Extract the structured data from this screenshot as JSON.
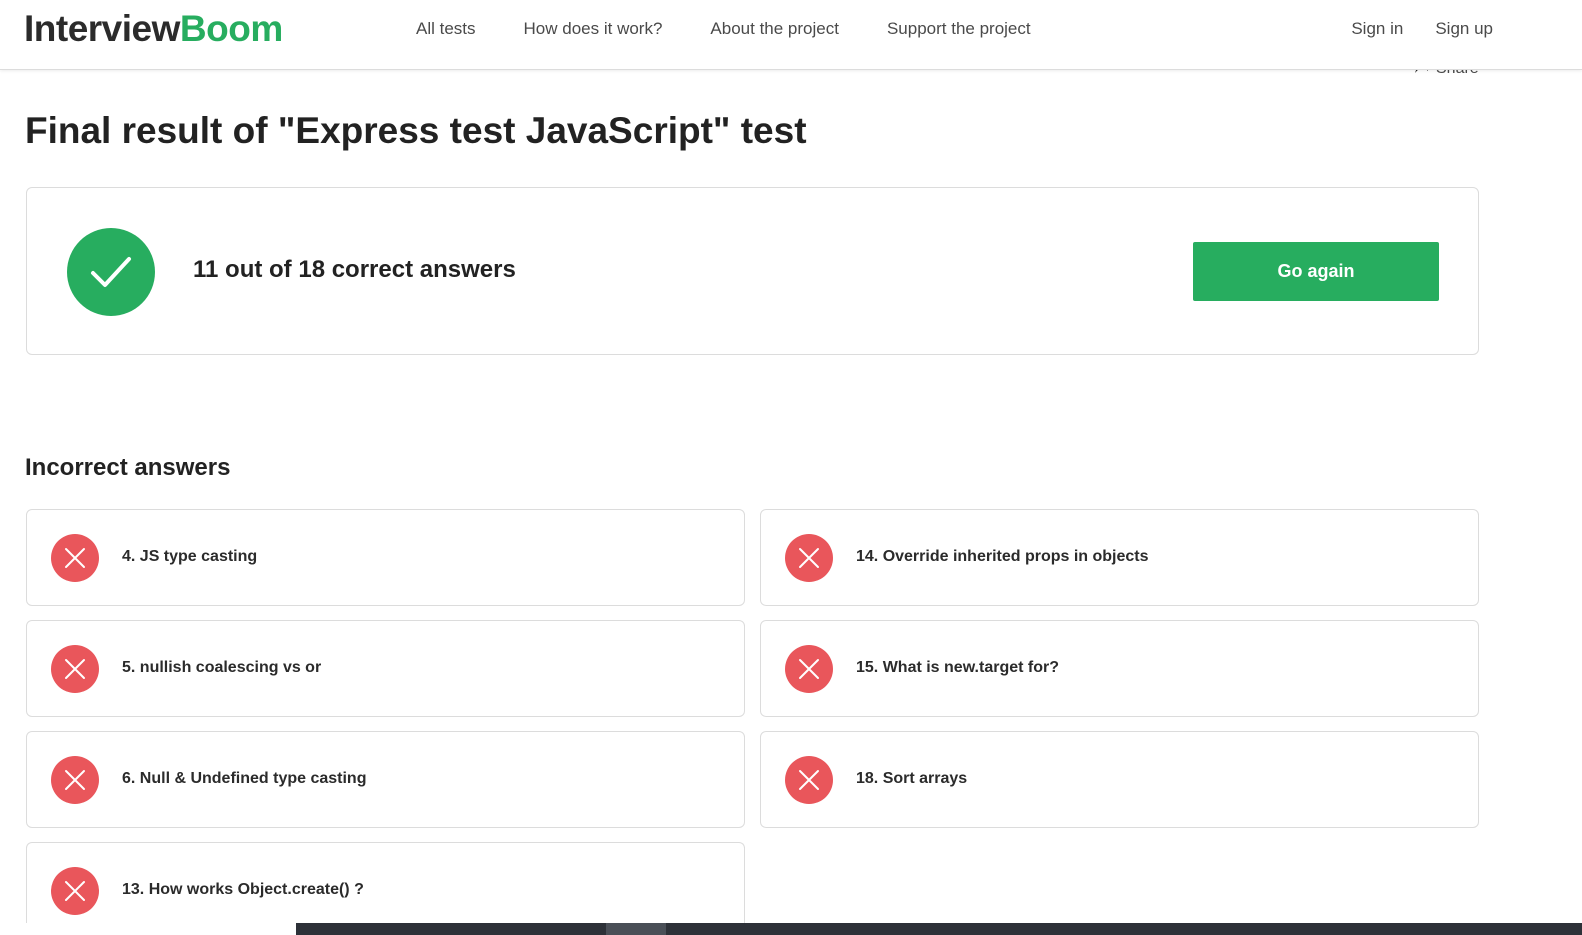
{
  "colors": {
    "brand_green": "#27ad5f",
    "logo_dark": "#2b2b2b",
    "error_red": "#e9565b",
    "border": "#dcdcdc"
  },
  "header": {
    "logo_part1": "Interview",
    "logo_part2": "Boom",
    "nav": [
      {
        "label": "All tests"
      },
      {
        "label": "How does it work?"
      },
      {
        "label": "About the project"
      },
      {
        "label": "Support the project"
      }
    ],
    "sign_in": "Sign in",
    "sign_up": "Sign up"
  },
  "share": {
    "label": "Share",
    "icon": "share-arrow-icon"
  },
  "main": {
    "title": "Final result of \"Express test JavaScript\" test",
    "result": {
      "icon": "checkmark-icon",
      "text": "11 out of 18 correct answers",
      "correct": 11,
      "total": 18,
      "button_label": "Go again"
    },
    "incorrect_title": "Incorrect answers",
    "incorrect_answers": [
      {
        "label": "4. JS type casting"
      },
      {
        "label": "14. Override inherited props in objects"
      },
      {
        "label": "5. nullish coalescing vs or"
      },
      {
        "label": "15. What is new.target for?"
      },
      {
        "label": "6. Null & Undefined type casting"
      },
      {
        "label": "18. Sort arrays"
      },
      {
        "label": "13. How works Object.create() ?"
      }
    ]
  }
}
